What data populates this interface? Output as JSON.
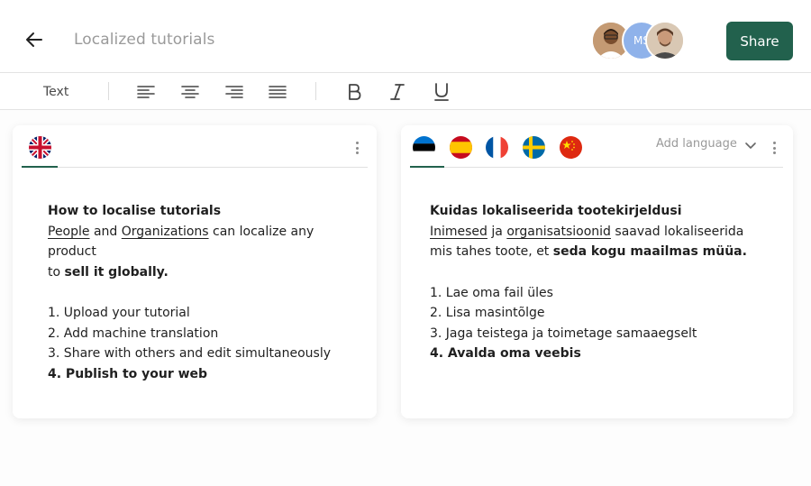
{
  "header": {
    "back_icon": "arrow-left-icon",
    "title": "Localized tutorials",
    "avatar_initials": "MS",
    "share_label": "Share",
    "share_color": "#22614d"
  },
  "toolbar": {
    "style_label": "Text",
    "icons": [
      "align-left-icon",
      "align-center-icon",
      "align-right-icon",
      "align-justify-icon",
      "bold-icon",
      "italic-icon",
      "underline-icon"
    ]
  },
  "source_panel": {
    "flag": "uk-flag-icon",
    "title": "How to localise tutorials",
    "intro_link1": "People",
    "intro_and": " and ",
    "intro_link2": "Organizations",
    "intro_rest": " can localize any product",
    "intro_line2_prefix": "to ",
    "intro_line2_bold": "sell it globally.",
    "steps": [
      "1.  Upload your tutorial",
      "2.  Add machine translation",
      "3.  Share with others and edit simultaneously",
      "4.  Publish to your web"
    ]
  },
  "target_panel": {
    "flags": [
      "estonia-flag-icon",
      "spain-flag-icon",
      "france-flag-icon",
      "sweden-flag-icon",
      "china-flag-icon"
    ],
    "add_language_label": "Add language",
    "title": "Kuidas lokaliseerida tootekirjeldusi",
    "intro_link1": "Inimesed",
    "intro_and": " ja ",
    "intro_link2": "organisatsioonid",
    "intro_rest": " saavad lokaliseerida",
    "intro_line2_prefix": "mis tahes toote, et ",
    "intro_line2_bold": "seda kogu maailmas müüa.",
    "steps": [
      "1.  Lae oma fail üles",
      "2. Lisa masintõlge",
      "3. Jaga teistega ja toimetage samaaegselt",
      "4. Avalda oma veebis"
    ]
  }
}
